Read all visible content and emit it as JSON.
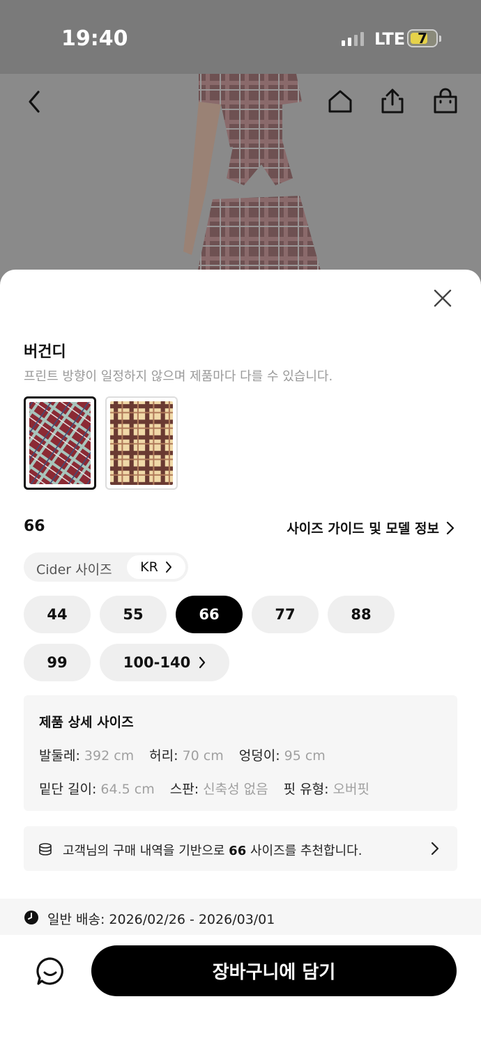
{
  "status_bar": {
    "time": "19:40",
    "network": "LTE",
    "battery": "7"
  },
  "nav": {
    "icons": [
      "back-icon",
      "home-icon",
      "share-icon",
      "shopping-bag-icon"
    ]
  },
  "sheet": {
    "color": {
      "name": "버건디",
      "note": "프린트 방향이 일정하지 않으며 제품마다 다를 수 있습니다.",
      "swatches": [
        {
          "name": "burgundy-plaid",
          "selected": true,
          "base": "#8b2a34",
          "line": "#9fb8b0"
        },
        {
          "name": "brown-plaid",
          "selected": false,
          "base": "#f0d9a8",
          "line": "#5a2e2a"
        }
      ]
    },
    "size": {
      "selected_label": "66",
      "guide_link": "사이즈 가이드 및 모델 정보",
      "system_label": "Cider 사이즈",
      "system_value": "KR",
      "options": [
        "44",
        "55",
        "66",
        "77",
        "88",
        "99",
        "100-140"
      ],
      "selected": "66"
    },
    "details": {
      "title": "제품 상세 사이즈",
      "row1": [
        {
          "k": "발둘레:",
          "v": "392 cm"
        },
        {
          "k": "허리:",
          "v": "70 cm"
        },
        {
          "k": "엉덩이:",
          "v": "95 cm"
        }
      ],
      "row2": [
        {
          "k": "밑단 길이:",
          "v": "64.5 cm"
        },
        {
          "k": "스판:",
          "v": "신축성 없음"
        },
        {
          "k": "핏 유형:",
          "v": "오버핏"
        }
      ]
    },
    "recommendation": {
      "before": "고객님의 구매 내역을 기반으로 ",
      "size": "66",
      "after": " 사이즈를 추천합니다."
    },
    "shipping": "일반 배송: 2026/02/26 - 2026/03/01",
    "cart_button": "장바구니에 담기"
  }
}
